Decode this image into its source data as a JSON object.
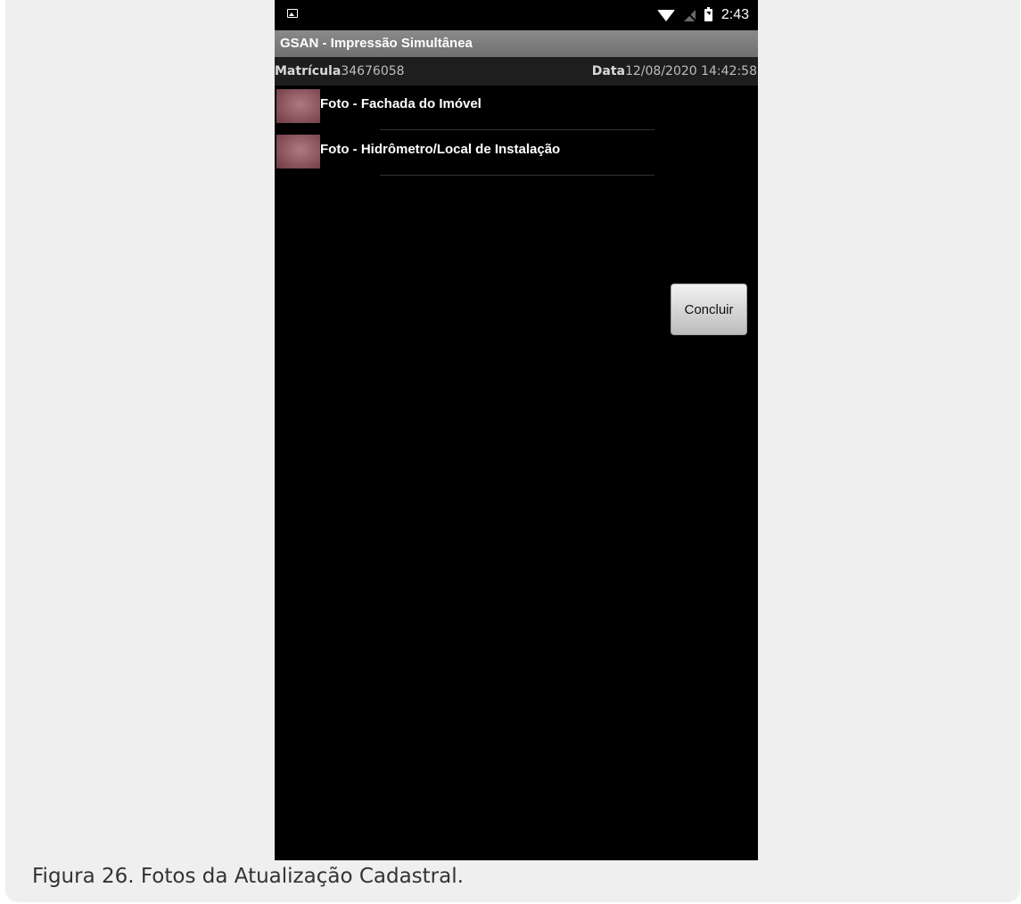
{
  "status_bar": {
    "time": "2:43",
    "icons": [
      "gallery-icon",
      "wifi-icon",
      "no-signal-icon",
      "battery-charging-icon"
    ]
  },
  "app": {
    "title": "GSAN - Impressão Simultânea"
  },
  "info": {
    "matricula_label": "Matrícula",
    "matricula_value": "34676058",
    "data_label": "Data",
    "data_value": "12/08/2020 14:42:58"
  },
  "photos": [
    {
      "label": "Foto - Fachada do Imóvel"
    },
    {
      "label": "Foto - Hidrômetro/Local de Instalação"
    }
  ],
  "actions": {
    "conclude_label": "Concluir"
  },
  "caption": "Figura 26. Fotos da Atualização Cadastral.",
  "colors": {
    "background": "#efefef",
    "screen": "#000000",
    "title_bar": "#7a7a7a"
  }
}
